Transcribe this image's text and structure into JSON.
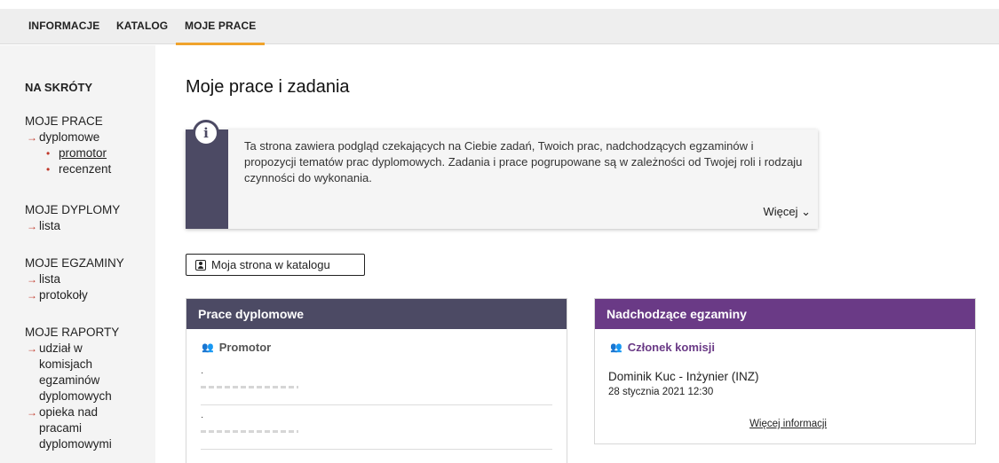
{
  "topnav": {
    "tabs": [
      {
        "label": "INFORMACJE"
      },
      {
        "label": "KATALOG"
      },
      {
        "label": "MOJE PRACE"
      }
    ]
  },
  "sidebar": {
    "heading": "NA SKRÓTY",
    "groups": [
      {
        "title": "MOJE PRACE",
        "items": [
          "dyplomowe"
        ],
        "subitems": [
          "promotor",
          "recenzent"
        ]
      },
      {
        "title": "MOJE DYPLOMY",
        "items": [
          "lista"
        ]
      },
      {
        "title": "MOJE EGZAMINY",
        "items": [
          "lista",
          "protokoły"
        ]
      },
      {
        "title": "MOJE RAPORTY",
        "items": [
          "udział w komisjach egzaminów dyplomowych",
          "opieka nad pracami dyplomowymi"
        ]
      }
    ]
  },
  "main": {
    "title": "Moje prace i zadania",
    "info": {
      "icon": "info-icon",
      "text": "Ta strona zawiera podgląd czekających na Ciebie zadań, Twoich prac, nadchodzących egzaminów i propozycji tematów prac dyplomowych. Zadania i prace pogrupowane są w zależności od Twojej roli i rodzaju czynności do wykonania.",
      "more_label": "Więcej ⌄"
    },
    "catalog_button": "Moja strona w katalogu",
    "theses_card": {
      "header": "Prace dyplomowe",
      "section_label": "Promotor",
      "entries": [
        "·",
        "·"
      ]
    },
    "exams_card": {
      "header": "Nadchodzące egzaminy",
      "section_label": "Członek komisji",
      "exam_title": "Dominik Kuc - Inżynier (INZ)",
      "exam_date": "28 stycznia 2021 12:30",
      "more_info": "Więcej informacji"
    }
  },
  "colors": {
    "nav_accent": "#f0a32c",
    "theses_header": "#4c4a64",
    "exams_header": "#6a3a86",
    "sidebar_arrow": "#c0392b"
  }
}
